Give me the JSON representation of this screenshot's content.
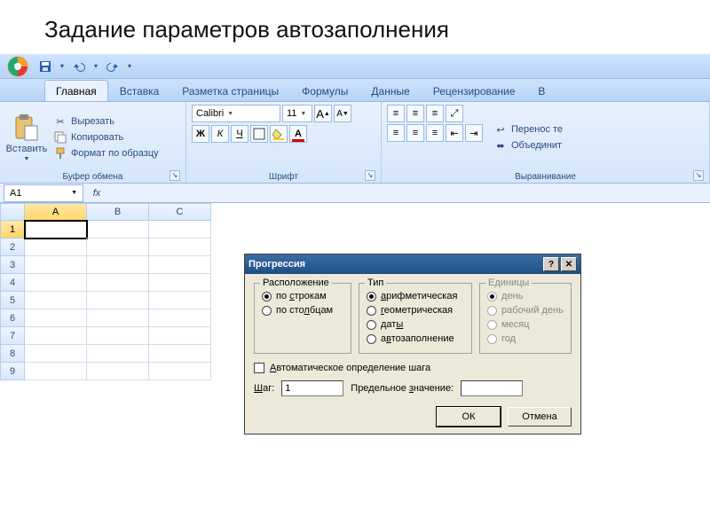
{
  "page": {
    "title": "Задание параметров автозаполнения"
  },
  "tabs": [
    "Главная",
    "Вставка",
    "Разметка страницы",
    "Формулы",
    "Данные",
    "Рецензирование",
    "В"
  ],
  "clipboard": {
    "paste": "Вставить",
    "cut": "Вырезать",
    "copy": "Копировать",
    "format_painter": "Формат по образцу",
    "group": "Буфер обмена"
  },
  "font": {
    "name": "Calibri",
    "size": "11",
    "bold": "Ж",
    "italic": "К",
    "underline": "Ч",
    "grow": "A",
    "shrink": "A",
    "group": "Шрифт"
  },
  "align": {
    "wrap": "Перенос те",
    "merge": "Объединит",
    "group": "Выравнивание"
  },
  "namebox": "A1",
  "columns": [
    "A",
    "B",
    "C"
  ],
  "rows": [
    "1",
    "2",
    "3",
    "4",
    "5",
    "6",
    "7",
    "8",
    "9"
  ],
  "dialog": {
    "title": "Прогрессия",
    "grp_loc": "Расположение",
    "loc_rows": "по строкам",
    "loc_cols": "по столбцам",
    "grp_type": "Тип",
    "type_arith": "арифметическая",
    "type_geom": "геометрическая",
    "type_dates": "даты",
    "type_auto": "автозаполнение",
    "grp_units": "Единицы",
    "u_day": "день",
    "u_wday": "рабочий день",
    "u_month": "месяц",
    "u_year": "год",
    "autostep": "Автоматическое определение шага",
    "step_label": "Шаг:",
    "step_value": "1",
    "limit_label": "Предельное значение:",
    "limit_value": "",
    "ok": "ОК",
    "cancel": "Отмена"
  }
}
